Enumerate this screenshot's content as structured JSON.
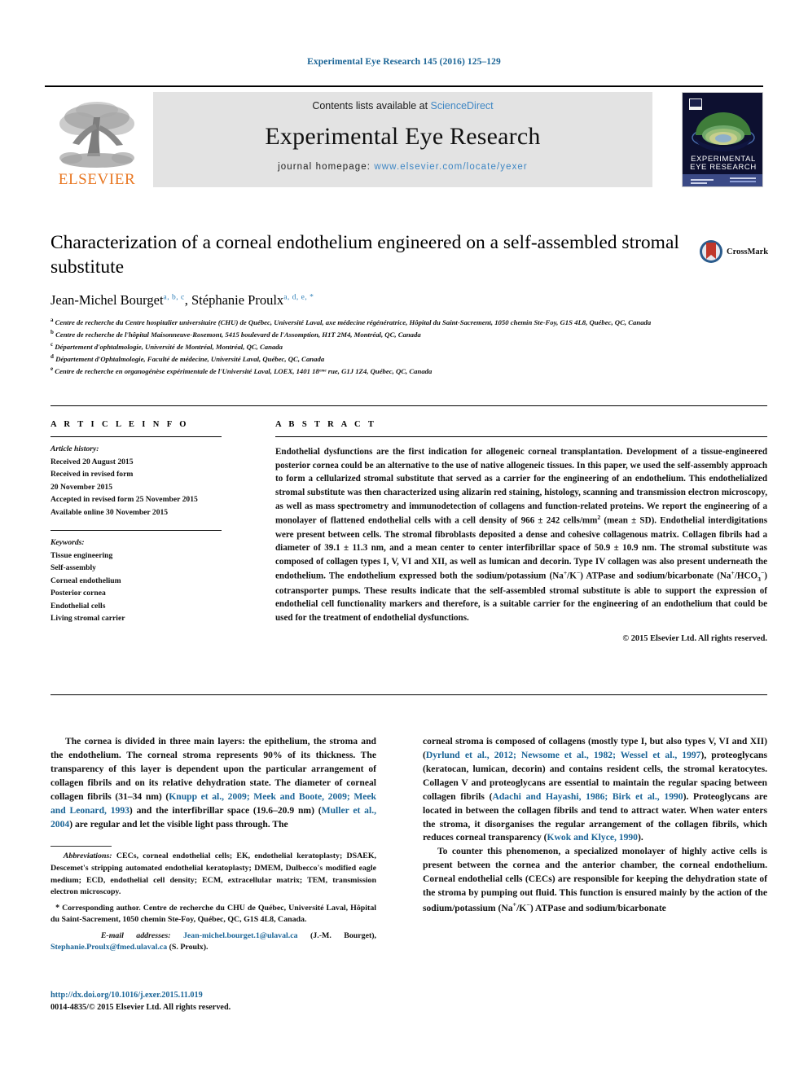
{
  "running_head": "Experimental Eye Research 145 (2016) 125–129",
  "masthead": {
    "contents_prefix": "Contents lists available at",
    "contents_link": "ScienceDirect",
    "journal_title": "Experimental Eye Research",
    "homepage_label": "journal homepage:",
    "homepage_url": "www.elsevier.com/locate/yexer",
    "publisher_wordmark": "ELSEVIER",
    "publisher_logo_icon": "elsevier-tree-icon",
    "cover_line1": "EXPERIMENTAL",
    "cover_line2": "EYE RESEARCH",
    "cover_icon": "journal-cover-eye-icon"
  },
  "article": {
    "title": "Characterization of a corneal endothelium engineered on a self-assembled stromal substitute",
    "authors": [
      {
        "name": "Jean-Michel Bourget",
        "marks": "a, b, c"
      },
      {
        "name": "Stéphanie Proulx",
        "marks": "a, d, e, *"
      }
    ],
    "crossmark_label": "CrossMark",
    "crossmark_icon": "crossmark-badge-icon",
    "affiliations": [
      {
        "mark": "a",
        "text": "Centre de recherche du Centre hospitalier universitaire (CHU) de Québec, Université Laval, axe médecine régénératrice, Hôpital du Saint-Sacrement, 1050 chemin Ste-Foy, G1S 4L8, Québec, QC, Canada"
      },
      {
        "mark": "b",
        "text": "Centre de recherche de l'hôpital Maisonneuve-Rosemont, 5415 boulevard de l'Assomption, H1T 2M4, Montréal, QC, Canada"
      },
      {
        "mark": "c",
        "text": "Département d'ophtalmologie, Université de Montréal, Montréal, QC, Canada"
      },
      {
        "mark": "d",
        "text": "Département d'Ophtalmologie, Faculté de médecine, Université Laval, Québec, QC, Canada"
      },
      {
        "mark": "e",
        "text": "Centre de recherche en organogénèse expérimentale de l'Université Laval, LOEX, 1401 18ᵉᵐᵉ rue, G1J 1Z4, Québec, QC, Canada"
      }
    ]
  },
  "article_info": {
    "heading": "A R T I C L E   I N F O",
    "history_label": "Article history:",
    "history": [
      "Received 20 August 2015",
      "Received in revised form",
      "20 November 2015",
      "Accepted in revised form 25 November 2015",
      "Available online 30 November 2015"
    ],
    "keywords_label": "Keywords:",
    "keywords": [
      "Tissue engineering",
      "Self-assembly",
      "Corneal endothelium",
      "Posterior cornea",
      "Endothelial cells",
      "Living stromal carrier"
    ]
  },
  "abstract": {
    "heading": "A B S T R A C T",
    "text_part1": "Endothelial dysfunctions are the first indication for allogeneic corneal transplantation. Development of a tissue-engineered posterior cornea could be an alternative to the use of native allogeneic tissues. In this paper, we used the self-assembly approach to form a cellularized stromal substitute that served as a carrier for the engineering of an endothelium. This endothelialized stromal substitute was then characterized using alizarin red staining, histology, scanning and transmission electron microscopy, as well as mass spectrometry and immunodetection of collagens and function-related proteins. We report the engineering of a monolayer of flattened endothelial cells with a cell density of 966 ± 242 cells/mm",
    "sup1": "2",
    "text_part2": " (mean ± SD). Endothelial interdigitations were present between cells. The stromal fibroblasts deposited a dense and cohesive collagenous matrix. Collagen fibrils had a diameter of 39.1 ± 11.3 nm, and a mean center to center interfibrillar space of 50.9 ± 10.9 nm. The stromal substitute was composed of collagen types I, V, VI and XII, as well as lumican and decorin. Type IV collagen was also present underneath the endothelium. The endothelium expressed both the sodium/potassium (Na",
    "sup2": "+",
    "text_part3": "/K",
    "sup3": "−",
    "text_part4": ") ATPase and sodium/bicarbonate (Na",
    "sup4": "+",
    "text_part5": "/HCO",
    "sub1": "3",
    "sup5": "−",
    "text_part6": ") cotransporter pumps. These results indicate that the self-assembled stromal substitute is able to support the expression of endothelial cell functionality markers and therefore, is a suitable carrier for the engineering of an endothelium that could be used for the treatment of endothelial dysfunctions.",
    "copyright": "© 2015 Elsevier Ltd. All rights reserved."
  },
  "body": {
    "left_para_1_a": "The cornea is divided in three main layers: the epithelium, the stroma and the endothelium. The corneal stroma represents 90% of its thickness. The transparency of this layer is dependent upon the particular arrangement of collagen fibrils and on its relative dehydration state. The diameter of corneal collagen fibrils (31–34 nm) (",
    "left_ref_1": "Knupp et al., 2009; Meek and Boote, 2009; Meek and Leonard, 1993",
    "left_para_1_b": ") and the interfibrillar space (19.6–20.9 nm) (",
    "left_ref_2": "Muller et al., 2004",
    "left_para_1_c": ") are regular and let the visible light pass through. The",
    "right_para_1_a": "corneal stroma is composed of collagens (mostly type I, but also types V, VI and XII) (",
    "right_ref_1": "Dyrlund et al., 2012; Newsome et al., 1982; Wessel et al., 1997",
    "right_para_1_b": "), proteoglycans (keratocan, lumican, decorin) and contains resident cells, the stromal keratocytes. Collagen V and proteoglycans are essential to maintain the regular spacing between collagen fibrils (",
    "right_ref_2": "Adachi and Hayashi, 1986; Birk et al., 1990",
    "right_para_1_c": "). Proteoglycans are located in between the collagen fibrils and tend to attract water. When water enters the stroma, it disorganises the regular arrangement of the collagen fibrils, which reduces corneal transparency (",
    "right_ref_3": "Kwok and Klyce, 1990",
    "right_para_1_d": ").",
    "right_para_2_a": "To counter this phenomenon, a specialized monolayer of highly active cells is present between the cornea and the anterior chamber, the corneal endothelium. Corneal endothelial cells (CECs) are responsible for keeping the dehydration state of the stroma by pumping out fluid. This function is ensured mainly by the action of the sodium/potassium (Na",
    "right_sup_1": "+",
    "right_para_2_b": "/K",
    "right_sup_2": "−",
    "right_para_2_c": ") ATPase and sodium/bicarbonate"
  },
  "footnotes": {
    "abbrev_label": "Abbreviations:",
    "abbrev_text": " CECs, corneal endothelial cells; EK, endothelial keratoplasty; DSAEK, Descemet's stripping automated endothelial keratoplasty; DMEM, Dulbecco's modified eagle medium; ECD, endothelial cell density; ECM, extracellular matrix; TEM, transmission electron microscopy.",
    "corresp_star": "*",
    "corresp_text": " Corresponding author. Centre de recherche du CHU de Québec, Université Laval, Hôpital du Saint-Sacrement, 1050 chemin Ste-Foy, Québec, QC, G1S 4L8, Canada.",
    "email_label": "E-mail addresses:",
    "email_1": "Jean-michel.bourget.1@ulaval.ca",
    "email_1_owner": " (J.-M. Bourget), ",
    "email_2": "Stephanie.Proulx@fmed.ulaval.ca",
    "email_2_owner": " (S. Proulx)."
  },
  "doi_block": {
    "doi": "http://dx.doi.org/10.1016/j.exer.2015.11.019",
    "issn_line": "0014-4835/© 2015 Elsevier Ltd. All rights reserved."
  },
  "colors": {
    "link_blue": "#1a6496",
    "sciencedirect_blue": "#3f87c4",
    "elsevier_orange": "#E87722",
    "grey_band": "#e3e3e3",
    "cover_navy": "#0d1030"
  }
}
